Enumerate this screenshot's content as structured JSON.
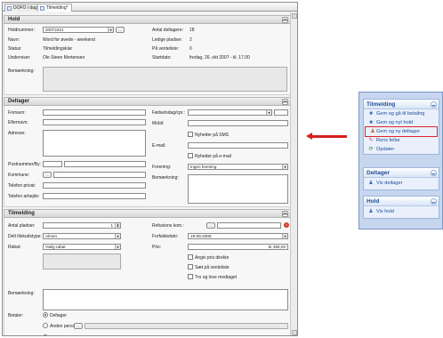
{
  "tabs": [
    {
      "label": "DOFO i dag"
    },
    {
      "label": "Tilmelding*"
    }
  ],
  "hold": {
    "title": "Hold",
    "holdnummer_label": "Holdnummer:",
    "holdnummer_value": "20072421",
    "navn_label": "Navn:",
    "navn_value": "Word for øvede - weekend",
    "status_label": "Status:",
    "status_value": "Tilmeldingsklar",
    "underviser_label": "Underviser:",
    "underviser_value": "Ole Steen Mortensen",
    "antal_label": "Antal deltagere:",
    "antal_value": "18",
    "ledige_label": "Ledige pladser:",
    "ledige_value": "2",
    "venteliste_label": "På venteliste:",
    "venteliste_value": "0",
    "startdato_label": "Startdato:",
    "startdato_value": "fredag, 26. okt 2007 - kl. 17.00",
    "bemaerkning_label": "Bemærkning:"
  },
  "deltager": {
    "title": "Deltager",
    "fornavn_label": "Fornavn:",
    "efternavn_label": "Efternavn:",
    "adresse_label": "Adresse:",
    "postnummer_label": "Postnummer/By:",
    "kommune_label": "Kommune:",
    "telefon_privat_label": "Telefon privat:",
    "telefon_arbejde_label": "Telefon arbejde:",
    "foedselsdag_label": "Fødselsdag/cpr.:",
    "mobil_label": "Mobil:",
    "nyheder_sms_label": "Nyheder på SMS",
    "email_label": "E-mail:",
    "nyheder_email_label": "Nyheder på e-mail",
    "forening_label": "Forening:",
    "forening_value": "Ingen forening",
    "bemaerkning_label": "Bemærkning:"
  },
  "tilmelding": {
    "title": "Tilmelding",
    "antal_pladser_label": "Antal pladser:",
    "antal_pladser_value": "1",
    "delt_label": "Delt tilskudstype:",
    "delt_value": "Almen",
    "rabat_label": "Rabat:",
    "rabat_value": "Vælg rabat",
    "refusion_label": "Refusions kom.:",
    "forfaldsdato_label": "Forfaldsdato:",
    "forfaldsdato_value": "19-06-2008",
    "pris_label": "Pris:",
    "pris_value": "kr 450,00",
    "angiv_label": "Angiv pris direkte",
    "saet_label": "Sæt på venteliste",
    "tro_label": "Tro og love modtaget",
    "bemaerkning_label": "Bemærkning:",
    "betaler_label": "Betaler:",
    "betaler_options": [
      "Deltager",
      "Anden person:",
      "Organisation:"
    ]
  },
  "task_panel": {
    "groups": [
      {
        "title": "Tilmelding",
        "items": [
          "Gem og gå til betaling",
          "Gem og nyt hold",
          "Gem og ny deltager",
          "Rens felter",
          "Opdater"
        ]
      },
      {
        "title": "Deltager",
        "items": [
          "Vis deltager"
        ]
      },
      {
        "title": "Hold",
        "items": [
          "Vis hold"
        ]
      }
    ]
  },
  "colors": {
    "highlight": "#e0242a",
    "panel_link": "#1f4b99",
    "arrow": "#d81e1e"
  }
}
